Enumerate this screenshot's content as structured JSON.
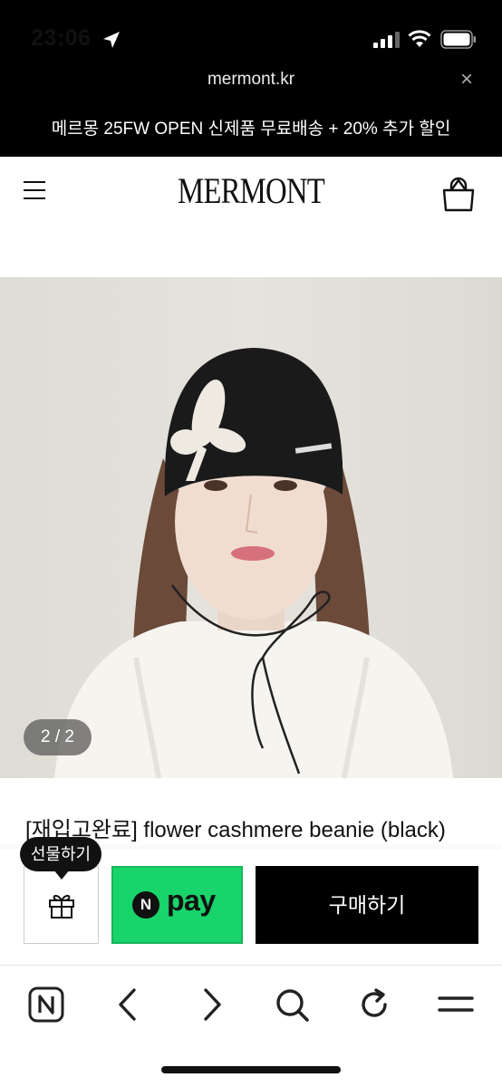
{
  "status_bar": {
    "time": "23:06",
    "icons": [
      "location-arrow-icon",
      "cellular-signal-icon",
      "wifi-icon",
      "battery-icon"
    ]
  },
  "browser": {
    "url": "mermont.kr",
    "close_symbol": "×"
  },
  "promo_banner": {
    "text": "메르몽 25FW OPEN 신제품 무료배송 + 20% 추가 할인"
  },
  "site_header": {
    "logo": "MERMONT",
    "menu_icon": "hamburger-menu-icon",
    "cart_icon": "shopping-bag-icon"
  },
  "product": {
    "image_counter": "2 / 2",
    "title": "[재입고완료] flower cashmere beanie (black)"
  },
  "purchase_bar": {
    "gift_tooltip": "선물하기",
    "gift_icon": "gift-icon",
    "npay_badge": "N",
    "npay_label": "pay",
    "buy_label": "구매하기",
    "npay_color": "#19d36b"
  },
  "toolbar": {
    "icons": [
      "naver-home-icon",
      "back-arrow-icon",
      "forward-arrow-icon",
      "search-icon",
      "refresh-icon",
      "menu-lines-icon"
    ]
  }
}
